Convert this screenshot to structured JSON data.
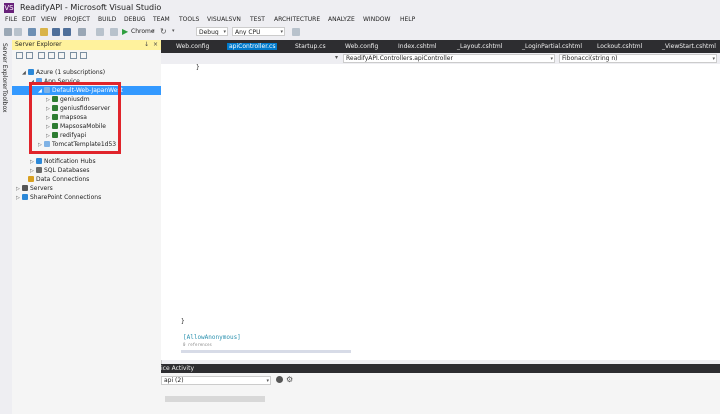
{
  "window": {
    "title": "ReadifyAPI - Microsoft Visual Studio",
    "logo": "VS"
  },
  "menu": [
    "FILE",
    "EDIT",
    "VIEW",
    "PROJECT",
    "BUILD",
    "DEBUG",
    "TEAM",
    "TOOLS",
    "VISUALSVN",
    "TEST",
    "ARCHITECTURE",
    "ANALYZE",
    "WINDOW",
    "HELP"
  ],
  "toolbar": {
    "browser": "Chrome",
    "config": "Debug",
    "platform": "Any CPU"
  },
  "sidebar": {
    "server_explorer_tab": "Server Explorer",
    "toolbox_tab": "Toolbox"
  },
  "server_explorer": {
    "title": "Server Explorer",
    "pin": "↓",
    "close": "×",
    "tree": [
      {
        "label": "Azure (1 subscriptions)",
        "expander": "◢",
        "icon_color": "#2b88d8"
      },
      {
        "label": "App Service",
        "expander": "◢",
        "icon_color": "#59a0e6"
      },
      {
        "label": "Default-Web-JapanWest",
        "expander": "◢",
        "icon_color": "#7fb2e5"
      },
      {
        "label": "geniusdm",
        "expander": "▷",
        "icon_color": "#2e7d32"
      },
      {
        "label": "geniusfidoserver",
        "expander": "▷",
        "icon_color": "#2e7d32"
      },
      {
        "label": "mapsosa",
        "expander": "▷",
        "icon_color": "#2e7d32"
      },
      {
        "label": "MapsosaMobile",
        "expander": "▷",
        "icon_color": "#2e7d32"
      },
      {
        "label": "redifyapi",
        "expander": "▷",
        "icon_color": "#2e7d32"
      },
      {
        "label": "TomcatTemplate1d53",
        "expander": "▷",
        "icon_color": "#7fb2e5"
      },
      {
        "label": "Notification Hubs",
        "expander": "▷",
        "icon_color": "#2b88d8"
      },
      {
        "label": "SQL Databases",
        "expander": "▷",
        "icon_color": "#6a6a6a"
      },
      {
        "label": "Data Connections",
        "expander": "",
        "icon_color": "#d8a020"
      },
      {
        "label": "Servers",
        "expander": "▷",
        "icon_color": "#555555"
      },
      {
        "label": "SharePoint Connections",
        "expander": "▷",
        "icon_color": "#2b88d8"
      }
    ]
  },
  "tabs": [
    "Web.config",
    "apiController.cs",
    "Startup.cs",
    "Web.config",
    "Index.cshtml",
    "_Layout.cshtml",
    "_LoginPartial.cshtml",
    "Lockout.cshtml",
    "_ViewStart.cshtml"
  ],
  "nav": {
    "class": "ReadifyAPI.Controllers.apiController",
    "member": "Fibonacci(string n)"
  },
  "code": {
    "brace_top": "}",
    "brace_bottom": "}",
    "attribute": "[AllowAnonymous]",
    "refs": "0 references"
  },
  "bottom_panel": {
    "title": "ice Activity",
    "combo": "api (2)"
  },
  "colors": {
    "accent": "#007acc",
    "highlight": "#fff29d",
    "red_box": "#e0242b",
    "selection": "#3399ff"
  }
}
